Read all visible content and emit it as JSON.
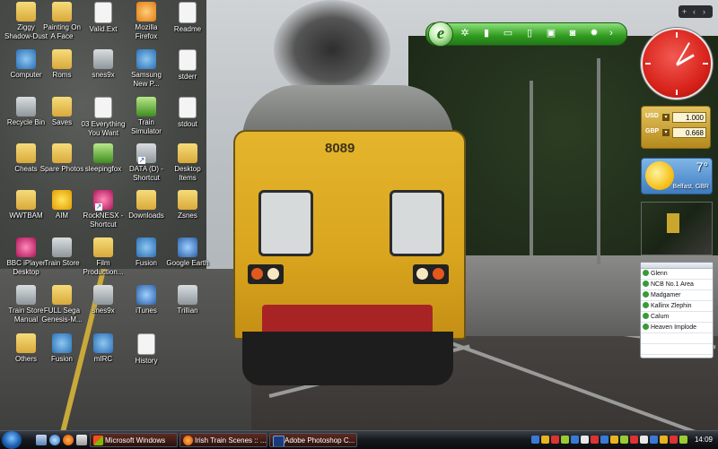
{
  "desktop": {
    "icons": [
      {
        "label": "Ziggy\nShadow-Dust",
        "icon": "folder-icon"
      },
      {
        "label": "Painting On\nA Face",
        "icon": "folder-icon"
      },
      {
        "label": "Valid.Ext",
        "icon": "document-icon"
      },
      {
        "label": "Mozilla\nFirefox",
        "icon": "firefox-icon"
      },
      {
        "label": "Readme",
        "icon": "document-icon"
      },
      {
        "label": "Computer",
        "icon": "computer-icon"
      },
      {
        "label": "Roms",
        "icon": "folder-icon"
      },
      {
        "label": "snes9x",
        "icon": "snes-icon"
      },
      {
        "label": "Samsung\nNew P...",
        "icon": "samsung-icon"
      },
      {
        "label": "stderr",
        "icon": "document-icon"
      },
      {
        "label": "Recycle Bin",
        "icon": "recycle-bin-icon"
      },
      {
        "label": "Saves",
        "icon": "folder-icon"
      },
      {
        "label": "03 Everything\nYou Want",
        "icon": "audio-file-icon"
      },
      {
        "label": "Train\nSimulator",
        "icon": "train-simulator-icon"
      },
      {
        "label": "stdout",
        "icon": "document-icon"
      },
      {
        "label": "Cheats",
        "icon": "folder-icon"
      },
      {
        "label": "Spare Photos",
        "icon": "folder-icon"
      },
      {
        "label": "sleepingfox",
        "icon": "image-icon"
      },
      {
        "label": "DATA (D) -\nShortcut",
        "icon": "drive-icon"
      },
      {
        "label": "Desktop\nItems",
        "icon": "folder-icon"
      },
      {
        "label": "WWTBAM",
        "icon": "folder-icon"
      },
      {
        "label": "AIM",
        "icon": "aim-icon"
      },
      {
        "label": "RockNESX -\nShortcut",
        "icon": "rocknesx-icon"
      },
      {
        "label": "Downloads",
        "icon": "downloads-folder-icon"
      },
      {
        "label": "Zsnes",
        "icon": "folder-icon"
      },
      {
        "label": "BBC iPlayer\nDesktop",
        "icon": "bbc-iplayer-icon"
      },
      {
        "label": "Train Store",
        "icon": "train-store-icon"
      },
      {
        "label": "Film\nProduction...",
        "icon": "folder-icon"
      },
      {
        "label": "Fusion",
        "icon": "fusion-icon"
      },
      {
        "label": "Google Earth",
        "icon": "google-earth-icon"
      },
      {
        "label": "Train Store\nManual",
        "icon": "manual-icon"
      },
      {
        "label": "FULL Sega\nGenesis-M...",
        "icon": "folder-icon"
      },
      {
        "label": "snes9x",
        "icon": "gamepad-icon"
      },
      {
        "label": "iTunes",
        "icon": "itunes-icon"
      },
      {
        "label": "Trillian",
        "icon": "trillian-icon"
      },
      {
        "label": "Others",
        "icon": "folder-icon"
      },
      {
        "label": "Fusion",
        "icon": "fusion-icon"
      },
      {
        "label": "mIRC",
        "icon": "mirc-icon"
      },
      {
        "label": "History",
        "icon": "document-icon"
      }
    ]
  },
  "wallpaper": {
    "train_number": "8089"
  },
  "gadgets": {
    "currency": {
      "rows": [
        {
          "code": "USD",
          "value": "1.000"
        },
        {
          "code": "GBP",
          "value": "0.668"
        }
      ]
    },
    "weather": {
      "temperature": "7°",
      "location": "Belfast, GBR"
    },
    "contacts": [
      "Glenn",
      "NCB No.1 Area",
      "Madgamer",
      "Kallinx Zlephin",
      "Calum",
      "Heaven Implode",
      "",
      ""
    ],
    "toolbar_logo": "e",
    "sidebar_controls": [
      "+",
      "‹",
      "›"
    ]
  },
  "taskbar": {
    "tasks": [
      {
        "label": "Microsoft Windows",
        "icon": "windows-icon"
      },
      {
        "label": "Irish Train Scenes :: ...",
        "icon": "firefox-icon"
      },
      {
        "label": "Adobe Photoshop C...",
        "icon": "photoshop-icon"
      }
    ],
    "clock": "14:09"
  },
  "colors": {
    "accent_green": "#2f9a1e",
    "clock_red": "#d8231b",
    "taskbar": "#15181d",
    "train_yellow": "#e4b52c"
  }
}
